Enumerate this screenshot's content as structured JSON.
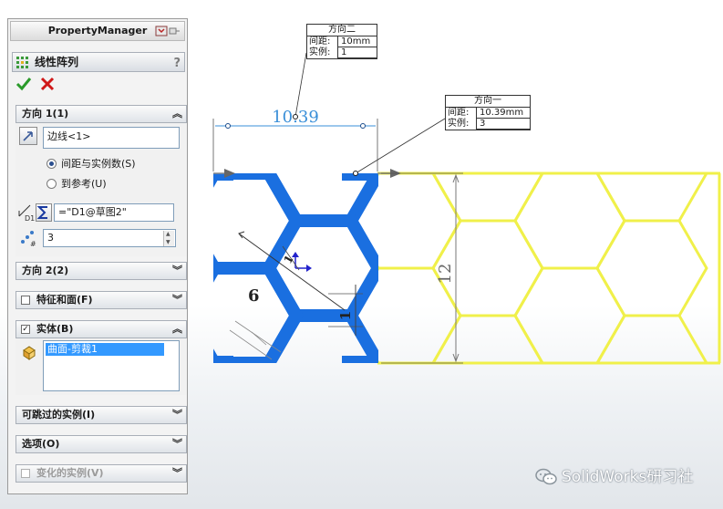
{
  "panel": {
    "title": "PropertyManager",
    "feature_name": "线性阵列",
    "help": "?",
    "direction1": {
      "header": "方向 1(1)",
      "edge_value": "边线<1>",
      "radio_spacing": "间距与实例数(S)",
      "radio_reference": "到参考(U)",
      "equation_value": "=\"D1@草图2\"",
      "spacing_label": "D1",
      "instances_label": "#",
      "instances_value": "3"
    },
    "direction2": {
      "header": "方向 2(2)"
    },
    "features_faces": {
      "header": "特征和面(F)"
    },
    "bodies": {
      "header": "实体(B)",
      "item": "曲面-剪裁1"
    },
    "skip_instances": {
      "header": "可跳过的实例(I)"
    },
    "options": {
      "header": "选项(O)"
    },
    "varying_instances": {
      "header": "变化的实例(V)"
    }
  },
  "callout_dir2": {
    "title": "方向二",
    "spacing_key": "间距:",
    "spacing_value": "10mm",
    "instances_key": "实例:",
    "instances_value": "1"
  },
  "callout_dir1": {
    "title": "方向一",
    "spacing_key": "间距:",
    "spacing_value": "10.39mm",
    "instances_key": "实例:",
    "instances_value": "3"
  },
  "dimensions": {
    "width": "10.39",
    "height": "12",
    "side": "6",
    "thickness": "1"
  },
  "watermark": "SolidWorks研习社",
  "colors": {
    "blue_body": "#1a6fe0",
    "yellow_preview": "#f0f04a",
    "dim_blue": "#3a8fd8",
    "dim_gray": "#555555"
  }
}
